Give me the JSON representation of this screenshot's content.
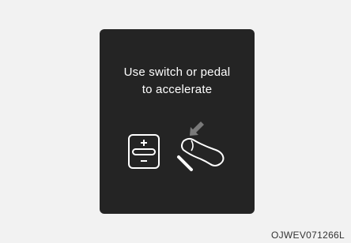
{
  "display": {
    "message_line1": "Use switch or pedal",
    "message_line2": "to accelerate",
    "icons": [
      "accelerator-switch-icon",
      "pedal-press-icon"
    ]
  },
  "caption": "OJWEV071266L"
}
